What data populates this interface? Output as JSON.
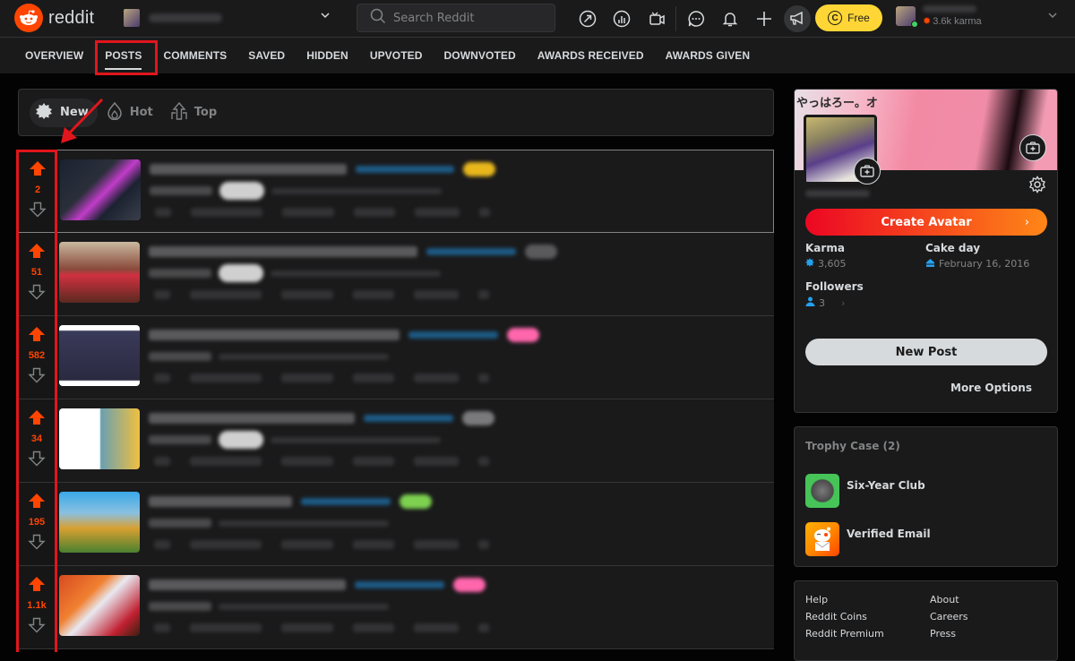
{
  "header": {
    "logo_text": "reddit",
    "search_placeholder": "Search Reddit",
    "free_label": "Free",
    "coin_symbol": "C",
    "karma_label": "3.6k karma",
    "icons": [
      "popular-icon",
      "stats-icon",
      "live-icon",
      "chat-icon",
      "notification-icon",
      "create-post-icon",
      "advertise-icon"
    ]
  },
  "tabs": [
    {
      "label": "OVERVIEW",
      "active": false
    },
    {
      "label": "POSTS",
      "active": true
    },
    {
      "label": "COMMENTS",
      "active": false
    },
    {
      "label": "SAVED",
      "active": false
    },
    {
      "label": "HIDDEN",
      "active": false
    },
    {
      "label": "UPVOTED",
      "active": false
    },
    {
      "label": "DOWNVOTED",
      "active": false
    },
    {
      "label": "AWARDS RECEIVED",
      "active": false
    },
    {
      "label": "AWARDS GIVEN",
      "active": false
    }
  ],
  "sort": {
    "new": "New",
    "hot": "Hot",
    "top": "Top",
    "active": "New"
  },
  "posts": [
    {
      "votes": "2",
      "flair_color": "#e8b71c"
    },
    {
      "votes": "51",
      "flair_color": "#5a5a5c"
    },
    {
      "votes": "582",
      "flair_color": "#ff66ac"
    },
    {
      "votes": "34",
      "flair_color": "#7a7a7c"
    },
    {
      "votes": "195",
      "flair_color": "#7dd050"
    },
    {
      "votes": "1.1k",
      "flair_color": "#ff66ac"
    }
  ],
  "profile": {
    "banner_text": "やっはろー。オ",
    "create_avatar": "Create Avatar",
    "karma_label": "Karma",
    "karma_value": "3,605",
    "cakeday_label": "Cake day",
    "cakeday_value": "February 16, 2016",
    "followers_label": "Followers",
    "followers_value": "3",
    "new_post": "New Post",
    "more_options": "More Options"
  },
  "trophies": {
    "title": "Trophy Case (2)",
    "items": [
      {
        "name": "Six-Year Club"
      },
      {
        "name": "Verified Email"
      }
    ]
  },
  "footer": {
    "links": [
      "Help",
      "About",
      "Reddit Coins",
      "Careers",
      "Reddit Premium",
      "Press"
    ]
  },
  "colors": {
    "accent": "#ff4500",
    "annotation": "#e0161c",
    "link_blue": "#24a0ed"
  }
}
